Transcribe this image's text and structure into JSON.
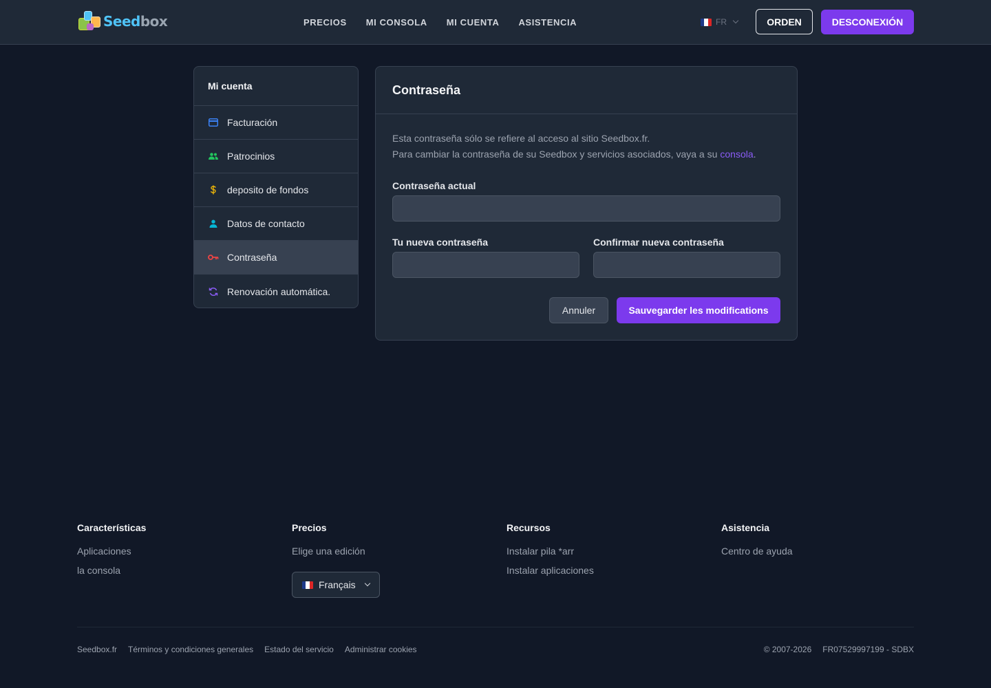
{
  "header": {
    "logo": {
      "part1": "Seed",
      "part2": "box"
    },
    "nav": [
      "PRECIOS",
      "MI CONSOLA",
      "MI CUENTA",
      "ASISTENCIA"
    ],
    "lang_code": "FR",
    "order_label": "ORDEN",
    "logout_label": "DESCONEXIÓN"
  },
  "sidebar": {
    "title": "Mi cuenta",
    "items": [
      {
        "label": "Facturación",
        "icon": "credit-card-icon",
        "color": "#3b82f6"
      },
      {
        "label": "Patrocinios",
        "icon": "users-icon",
        "color": "#22c55e"
      },
      {
        "label": "deposito de fondos",
        "icon": "dollar-icon",
        "color": "#eab308"
      },
      {
        "label": "Datos de contacto",
        "icon": "user-icon",
        "color": "#06b6d4"
      },
      {
        "label": "Contraseña",
        "icon": "key-icon",
        "color": "#ef4444",
        "active": true
      },
      {
        "label": "Renovación automática.",
        "icon": "refresh-icon",
        "color": "#8b5cf6"
      }
    ]
  },
  "card": {
    "title": "Contraseña",
    "desc_line1": "Esta contraseña sólo se refiere al acceso al sitio Seedbox.fr.",
    "desc_line2": "Para cambiar la contraseña de su Seedbox y servicios asociados, vaya a su",
    "desc_link": "consola",
    "desc_end": ".",
    "current_label": "Contraseña actual",
    "new_label": "Tu nueva contraseña",
    "confirm_label": "Confirmar nueva contraseña",
    "current_value": "",
    "new_value": "",
    "confirm_value": "",
    "cancel_label": "Annuler",
    "save_label": "Sauvegarder les modifications"
  },
  "footer": {
    "col1": {
      "title": "Características",
      "links": [
        "Aplicaciones",
        "la consola"
      ]
    },
    "col2": {
      "title": "Precios",
      "links": [
        "Elige una edición"
      ],
      "lang_label": "Français"
    },
    "col3": {
      "title": "Recursos",
      "links": [
        "Instalar pila *arr",
        "Instalar aplicaciones"
      ]
    },
    "col4": {
      "title": "Asistencia",
      "links": [
        "Centro de ayuda"
      ]
    },
    "bottom_links": [
      "Seedbox.fr",
      "Términos y condiciones generales",
      "Estado del servicio",
      "Administrar cookies"
    ],
    "copyright": "© 2007-2026",
    "company_id": "FR07529997199 - SDBX"
  },
  "colors": {
    "accent": "#7c3aed",
    "background": "#111827",
    "panel": "#1f2937",
    "link": "#8b5cf6"
  }
}
